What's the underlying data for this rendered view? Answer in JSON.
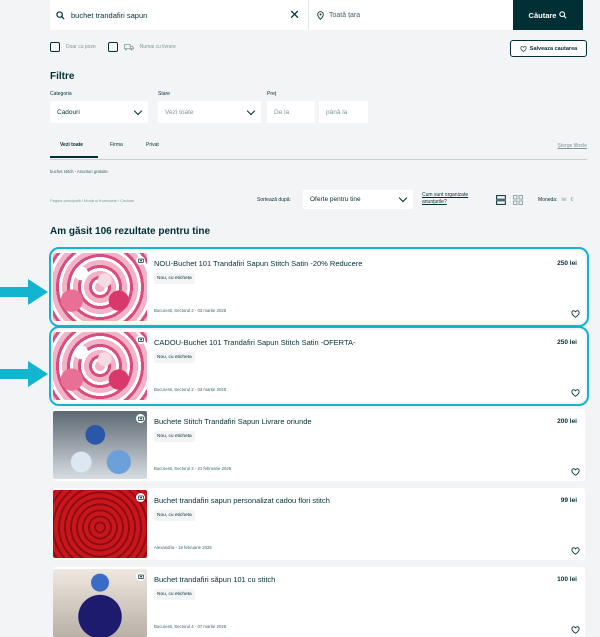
{
  "search": {
    "query": "buchet trandafiri sapun",
    "location_placeholder": "Toată țara",
    "button_label": "Căutare"
  },
  "options": {
    "only_with_photo": "Doar cu poze",
    "only_with_delivery": "Numai cu livrare",
    "save_search": "Salveaza cautarea"
  },
  "filters": {
    "title": "Filtre",
    "category_label": "Categoria",
    "category_value": "Cadouri",
    "state_label": "Stare",
    "state_value": "Vezi toate",
    "price_label": "Preț",
    "price_from": "De la",
    "price_to": "până la"
  },
  "tabs": [
    {
      "label": "Vezi toate",
      "active": true
    },
    {
      "label": "Firma",
      "active": false
    },
    {
      "label": "Privat",
      "active": false
    }
  ],
  "clear_filters": "Șterge filtrele",
  "subcategory": "buchet stitch - Anunturi gratuite",
  "breadcrumb": "Pagina principală / Moda și frumusețe / Cadouri",
  "sort": {
    "label": "Sortează după:",
    "value": "Oferte pentru tine",
    "how_link": "Cum sunt organizate anunțurile?"
  },
  "currency": {
    "label": "Moneda:",
    "value": "lei",
    "alt": "€"
  },
  "results_title": "Am găsit 106 rezultate pentru tine",
  "listings": [
    {
      "title": "NOU-Buchet 101 Trandafiri Sapun Stitch Satin -20% Reducere",
      "condition": "Nou, cu eticheta",
      "price": "250 lei",
      "location": "Bucuresti, Sectorul 2 - 03 martie 2025",
      "image": "pink",
      "highlighted": true
    },
    {
      "title": "CADOU-Buchet 101 Trandafiri Sapun Stitch Satin -OFERTA-",
      "condition": "Nou, cu eticheta",
      "price": "250 lei",
      "location": "Bucuresti, Sectorul 2 - 03 martie 2025",
      "image": "pink",
      "highlighted": true
    },
    {
      "title": "Buchete Stitch Trandafiri Sapun Livrare oriunde",
      "condition": "Nou, cu eticheta",
      "price": "200 lei",
      "location": "Bucuresti, Sectorul 2 - 21 februarie 2025",
      "image": "blue",
      "highlighted": false
    },
    {
      "title": "Buchet trandafiri sapun personalizat cadou flori stitch",
      "condition": "Nou, cu eticheta",
      "price": "99 lei",
      "location": "Alexandria - 18 februarie 2025",
      "image": "red",
      "highlighted": false
    },
    {
      "title": "Buchet trandafiri săpun 101 cu stitch",
      "condition": "Nou, cu eticheta",
      "price": "100 lei",
      "location": "Bucuresti, Sectorul 4 - 07 martie 2025",
      "image": "navy",
      "highlighted": false
    }
  ],
  "colors": {
    "highlight": "#12b4d0",
    "brand": "#002f34"
  }
}
